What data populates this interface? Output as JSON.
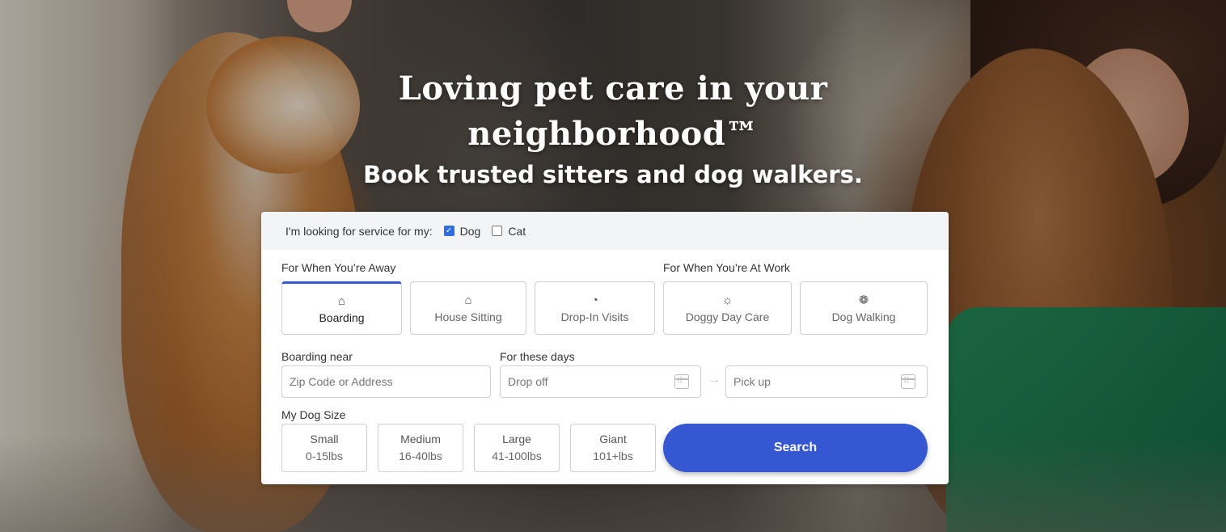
{
  "hero": {
    "title": "Loving pet care in your neighborhood™",
    "subtitle": "Book trusted sitters and dog walkers."
  },
  "pet_selector": {
    "label": "I'm looking for service for my:",
    "options": [
      {
        "label": "Dog",
        "checked": true
      },
      {
        "label": "Cat",
        "checked": false
      }
    ]
  },
  "services": {
    "away_label": "For When You’re Away",
    "work_label": "For When You’re At Work",
    "items": [
      {
        "label": "Boarding",
        "icon": "boarding-icon",
        "active": true
      },
      {
        "label": "House Sitting",
        "icon": "house-sitting-icon",
        "active": false
      },
      {
        "label": "Drop-In Visits",
        "icon": "drop-in-visits-icon",
        "active": false
      },
      {
        "label": "Doggy Day Care",
        "icon": "doggy-day-care-icon",
        "active": false
      },
      {
        "label": "Dog Walking",
        "icon": "dog-walking-icon",
        "active": false
      }
    ]
  },
  "location": {
    "label": "Boarding near",
    "placeholder": "Zip Code or Address"
  },
  "dates": {
    "label": "For these days",
    "drop_off_placeholder": "Drop off",
    "pick_up_placeholder": "Pick up"
  },
  "dog_size": {
    "label": "My Dog Size",
    "options": [
      {
        "name": "Small",
        "range": "0-15lbs"
      },
      {
        "name": "Medium",
        "range": "16-40lbs"
      },
      {
        "name": "Large",
        "range": "41-100lbs"
      },
      {
        "name": "Giant",
        "range": "101+lbs"
      }
    ]
  },
  "search_button": "Search",
  "colors": {
    "accent": "#3557d1",
    "checkbox": "#2f6de1",
    "panel_header": "#f3f4f6"
  }
}
